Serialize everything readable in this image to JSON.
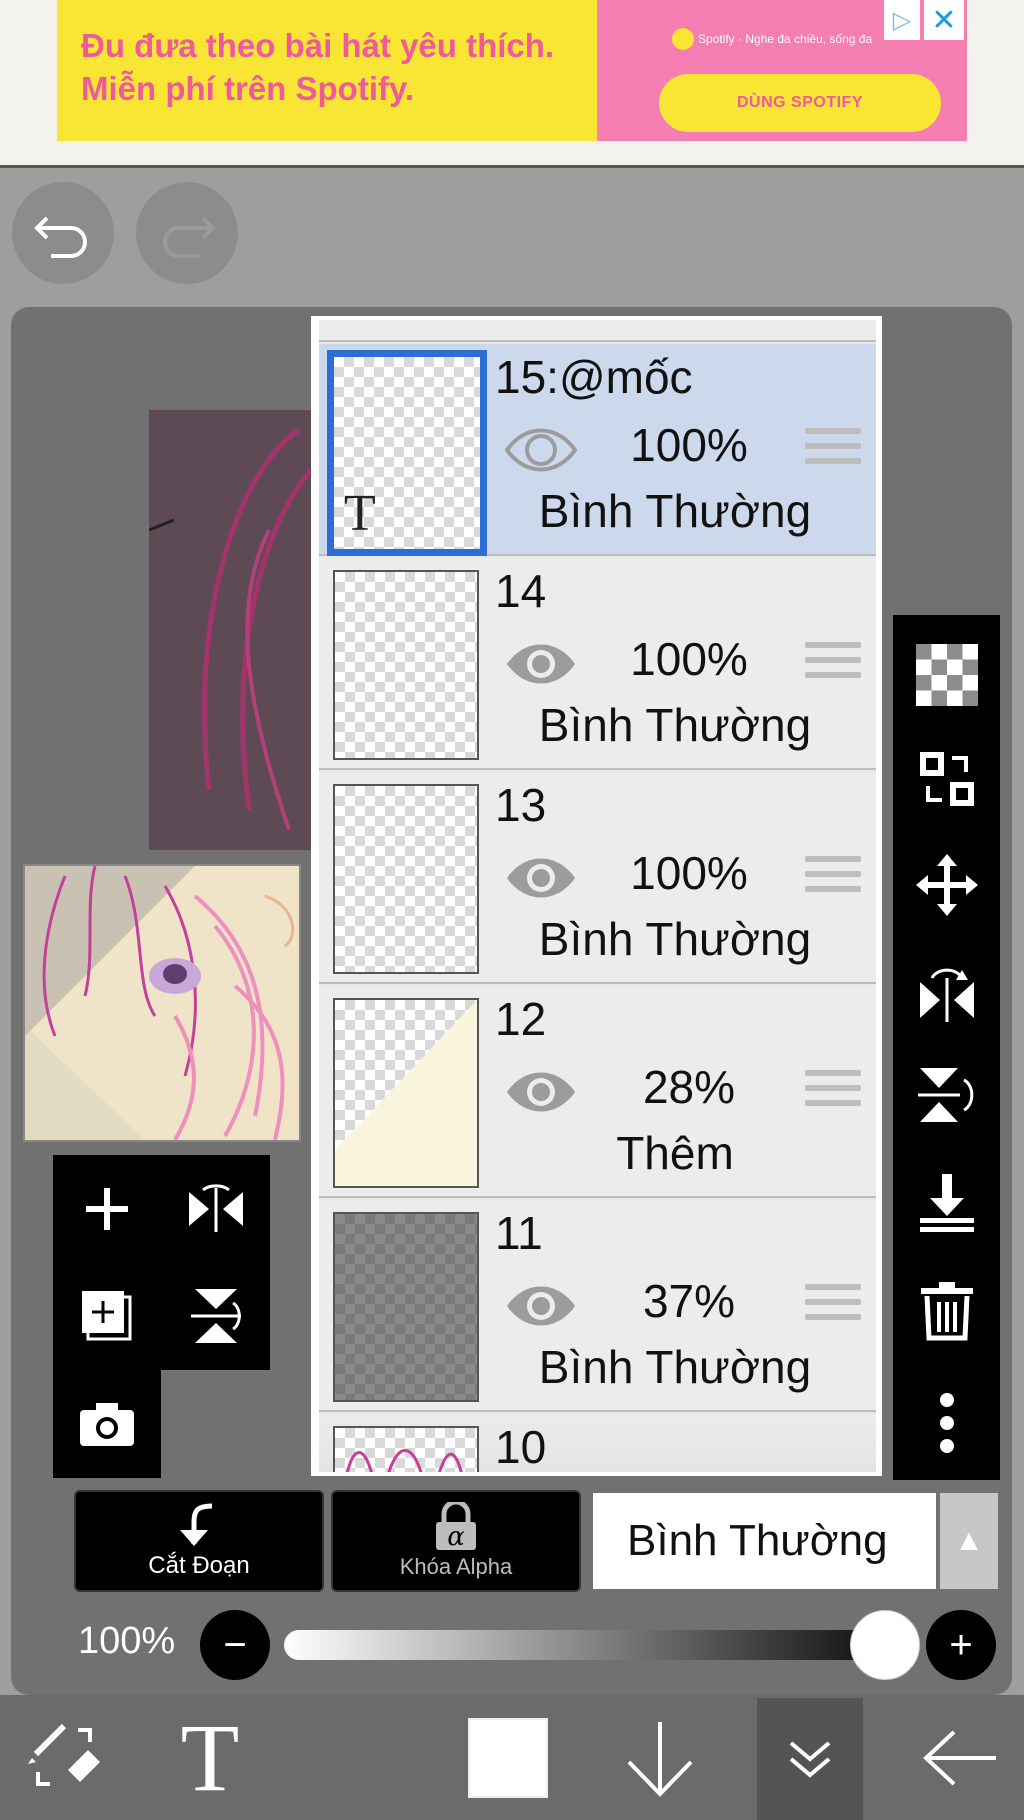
{
  "ad": {
    "headline": "Đu đưa theo bài hát yêu thích. Miễn phí trên Spotify.",
    "brand": "Spotify · Nghe đa chiều, sống đa",
    "cta": "DÙNG SPOTIFY",
    "close": "✕",
    "info": "▷"
  },
  "toolbar": {
    "undo_icon": "undo-icon",
    "redo_icon": "redo-icon"
  },
  "layers": {
    "items": [
      {
        "name": "15:@mốc",
        "opacity": "100%",
        "mode": "Bình Thường",
        "selected": true,
        "thumb_text": "T"
      },
      {
        "name": "14",
        "opacity": "100%",
        "mode": "Bình Thường"
      },
      {
        "name": "13",
        "opacity": "100%",
        "mode": "Bình Thường"
      },
      {
        "name": "12",
        "opacity": "28%",
        "mode": "Thêm"
      },
      {
        "name": "11",
        "opacity": "37%",
        "mode": "Bình Thường"
      },
      {
        "name": "10"
      }
    ]
  },
  "left_tools": [
    "add-layer",
    "flip-horizontal",
    "add-copy",
    "flip-vertical",
    "camera"
  ],
  "right_tools": [
    "transparency",
    "swap",
    "move",
    "flip-h",
    "flip-v",
    "merge-down",
    "delete",
    "more"
  ],
  "bottom": {
    "clip_label": "Cắt Đoạn",
    "alpha_lock_label": "Khóa Alpha",
    "blend_mode": "Bình Thường",
    "opacity_label": "100%",
    "opacity_value": 1.0
  },
  "nav": [
    "brush-eraser-icon",
    "text-tool-icon",
    "color-swatch",
    "down-arrow-icon",
    "collapse-icon",
    "back-arrow-icon"
  ]
}
